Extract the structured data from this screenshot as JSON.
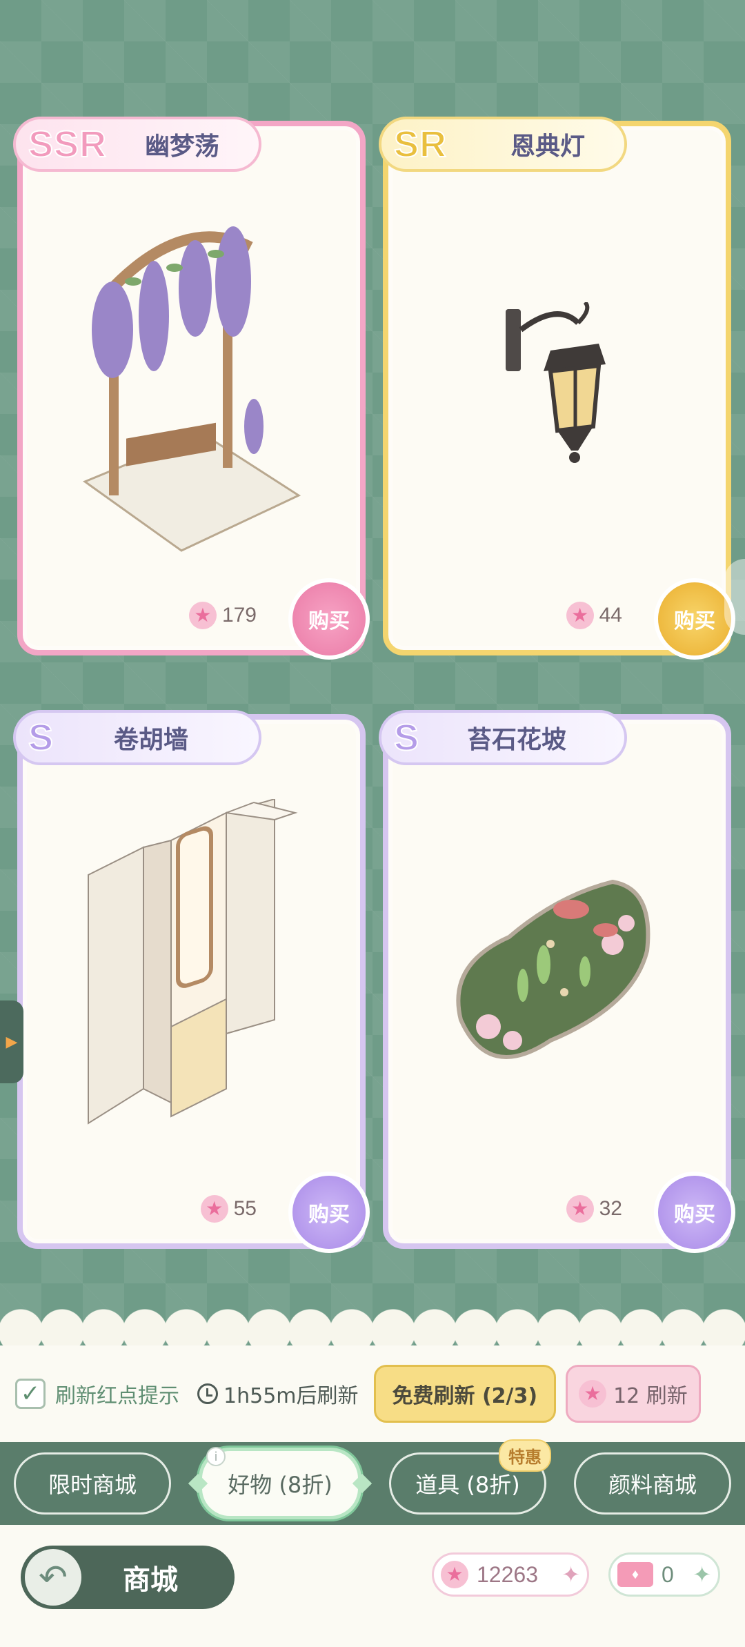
{
  "items": [
    {
      "rarity": "SSR",
      "name": "幽梦荡",
      "price": "179",
      "buy_label": "购买"
    },
    {
      "rarity": "SR",
      "name": "恩典灯",
      "price": "44",
      "buy_label": "购买"
    },
    {
      "rarity": "S",
      "name": "卷胡墙",
      "price": "55",
      "buy_label": "购买"
    },
    {
      "rarity": "S",
      "name": "苔石花坡",
      "price": "32",
      "buy_label": "购买"
    }
  ],
  "refresh": {
    "checkbox_label": "刷新红点提示",
    "timer": "1h55m后刷新",
    "free_refresh": "免费刷新 (2/3)",
    "paid_refresh": "12 刷新"
  },
  "tabs": [
    {
      "label": "限时商城",
      "active": false
    },
    {
      "label": "好物 (8折)",
      "active": true
    },
    {
      "label": "道具 (8折)",
      "active": false,
      "badge": "特惠"
    },
    {
      "label": "颜料商城",
      "active": false
    }
  ],
  "footer": {
    "title": "商城",
    "star_balance": "12263",
    "ticket_balance": "0"
  },
  "icons": {
    "currency": "star-icon",
    "timer": "clock-icon",
    "back": "back-arrow-icon"
  },
  "colors": {
    "ssr": "#f3a6c6",
    "sr": "#f4d56f",
    "s": "#d6c6f0",
    "accent_green": "#5a7d6b"
  }
}
